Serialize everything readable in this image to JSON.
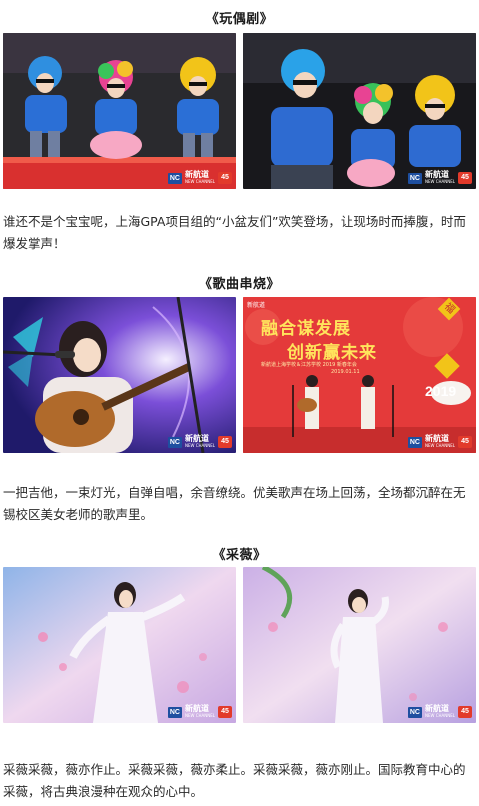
{
  "sections": [
    {
      "title": "《玩偶剧》",
      "caption": "谁还不是个宝宝呢，上海GPA项目组的“小盆友们”欢笑登场，让现场时而捧腹，时而爆发掌声！"
    },
    {
      "title": "《歌曲串烧》",
      "caption": "一把吉他，一束灯光，自弹自唱，余音缭绕。优美歌声在场上回荡，全场都沉醉在无锡校区美女老师的歌声里。"
    },
    {
      "title": "《采薇》",
      "caption": "采薇采薇，薇亦作止。采薇采薇，薇亦柔止。采薇采薇，薇亦刚止。国际教育中心的采薇，将古典浪漫种在观众的心中。"
    }
  ],
  "watermark": {
    "logo_abbr": "NC",
    "brand_cn": "新航道",
    "brand_en": "NEW CHANNEL",
    "badge": "45"
  },
  "stage_banner": {
    "line1": "融合谋发展",
    "line2": "创新赢未来",
    "subtitle": "新航道上海学校＆江苏学校 2019 新春年会",
    "date": "2019.01.11",
    "year": "2019",
    "fu": "福"
  },
  "colors": {
    "stage_red": "#e43a3a",
    "brand_blue": "#1e4fa0"
  }
}
